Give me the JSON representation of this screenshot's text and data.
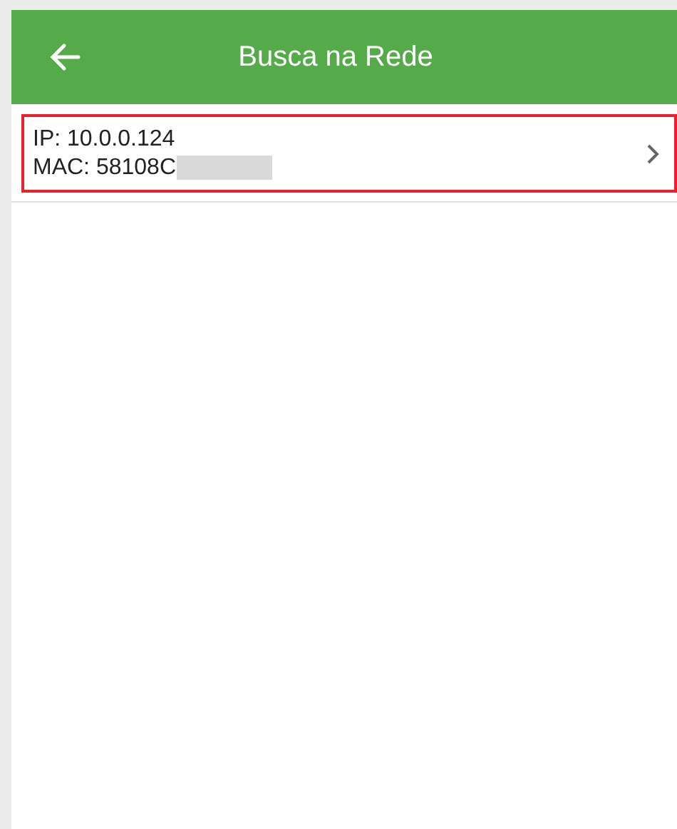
{
  "header": {
    "title": "Busca na Rede"
  },
  "devices": [
    {
      "ip": "IP: 10.0.0.124",
      "mac": "MAC: 58108C",
      "selected": true
    }
  ]
}
